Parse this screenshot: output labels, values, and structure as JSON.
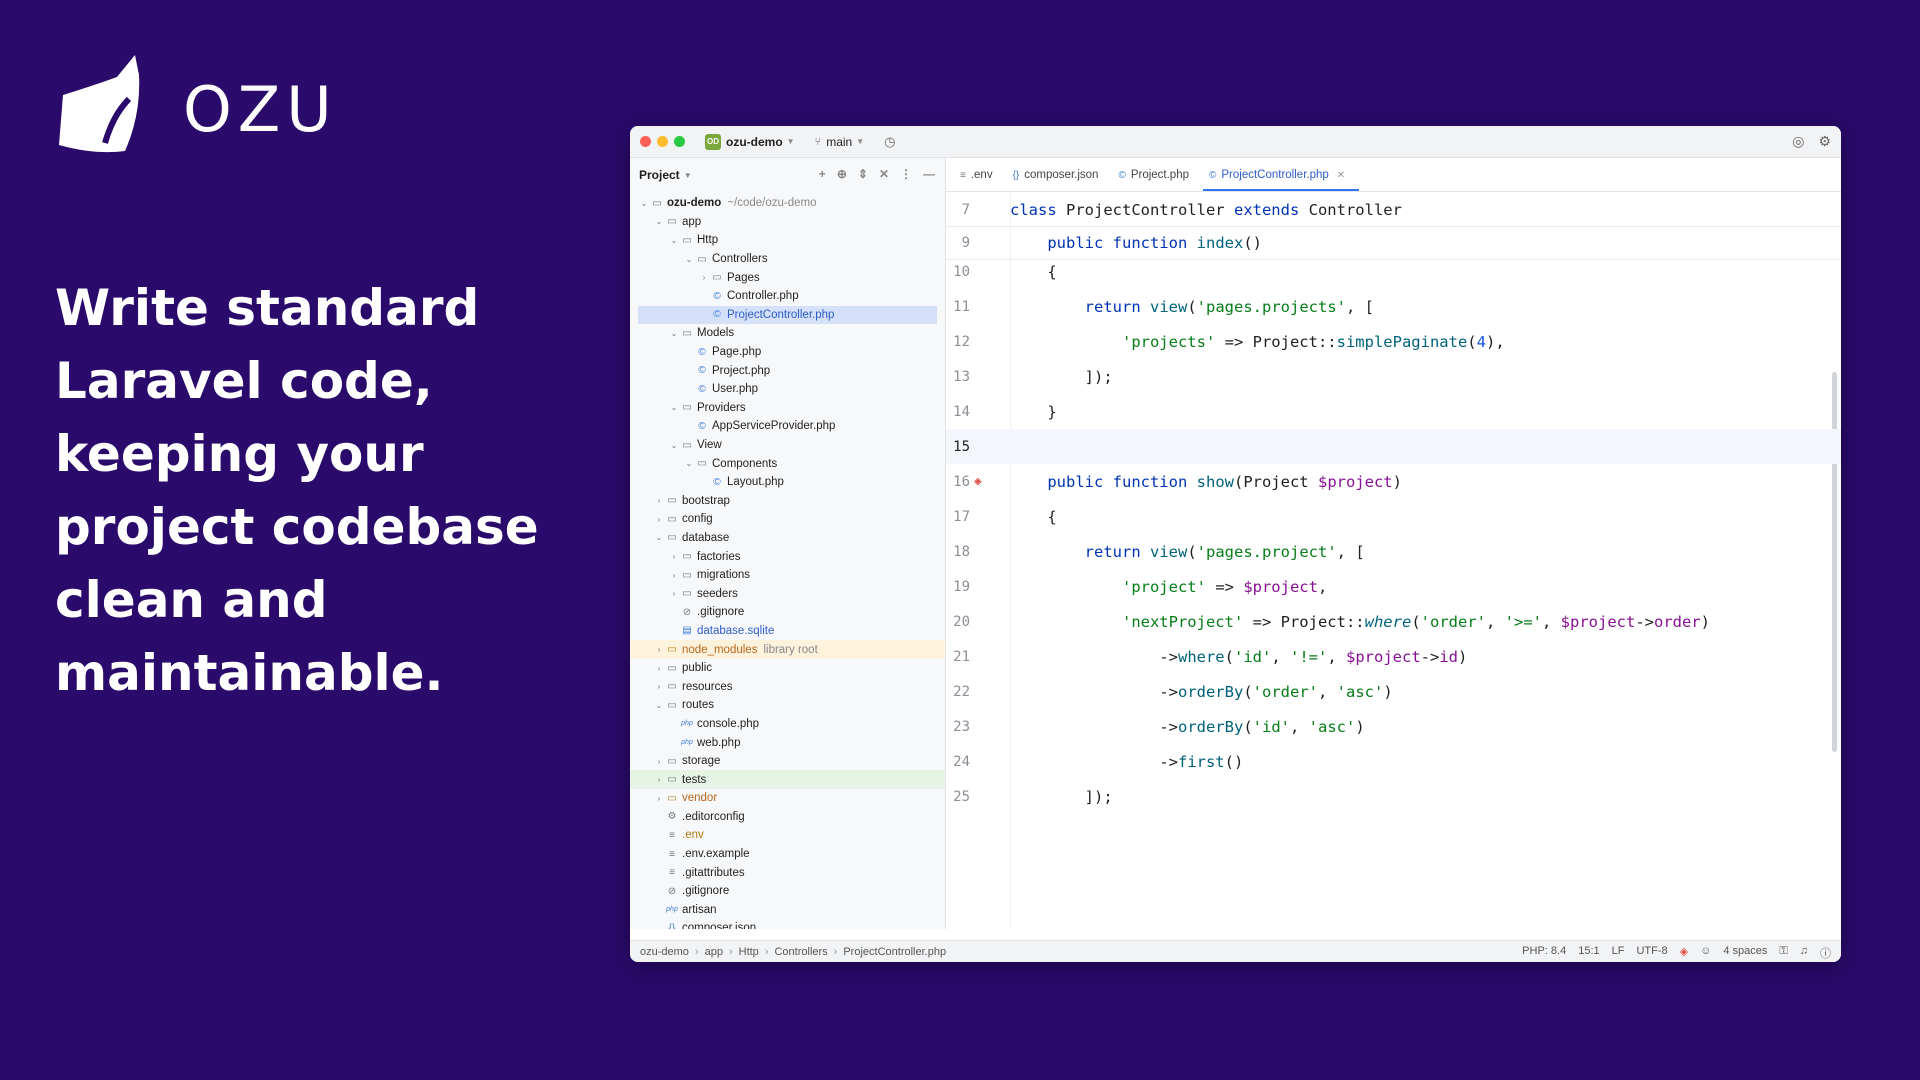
{
  "brand": {
    "name": "OZU",
    "logo_icon": "ozu-logo-icon"
  },
  "headline": "Write standard Laravel code, keeping your project codebase clean and maintainable.",
  "ide": {
    "project_name": "ozu-demo",
    "project_avatar": "OD",
    "branch": "main",
    "sidebar_title": "Project",
    "tree": [
      {
        "depth": 0,
        "arrow": "⌄",
        "icon": "folder",
        "label": "ozu-demo",
        "sub": "~/code/ozu-demo",
        "bold": true
      },
      {
        "depth": 1,
        "arrow": "⌄",
        "icon": "folder",
        "label": "app"
      },
      {
        "depth": 2,
        "arrow": "⌄",
        "icon": "folder",
        "label": "Http"
      },
      {
        "depth": 3,
        "arrow": "⌄",
        "icon": "folder",
        "label": "Controllers"
      },
      {
        "depth": 4,
        "arrow": "›",
        "icon": "folder",
        "label": "Pages"
      },
      {
        "depth": 4,
        "arrow": "",
        "icon": "php",
        "label": "Controller.php"
      },
      {
        "depth": 4,
        "arrow": "",
        "icon": "php",
        "label": "ProjectController.php",
        "selected": true
      },
      {
        "depth": 2,
        "arrow": "⌄",
        "icon": "folder",
        "label": "Models"
      },
      {
        "depth": 3,
        "arrow": "",
        "icon": "php",
        "label": "Page.php"
      },
      {
        "depth": 3,
        "arrow": "",
        "icon": "php",
        "label": "Project.php"
      },
      {
        "depth": 3,
        "arrow": "",
        "icon": "php",
        "label": "User.php"
      },
      {
        "depth": 2,
        "arrow": "⌄",
        "icon": "folder",
        "label": "Providers"
      },
      {
        "depth": 3,
        "arrow": "",
        "icon": "php",
        "label": "AppServiceProvider.php"
      },
      {
        "depth": 2,
        "arrow": "⌄",
        "icon": "folder",
        "label": "View"
      },
      {
        "depth": 3,
        "arrow": "⌄",
        "icon": "folder",
        "label": "Components"
      },
      {
        "depth": 4,
        "arrow": "",
        "icon": "php",
        "label": "Layout.php"
      },
      {
        "depth": 1,
        "arrow": "›",
        "icon": "folder",
        "label": "bootstrap"
      },
      {
        "depth": 1,
        "arrow": "›",
        "icon": "folder",
        "label": "config"
      },
      {
        "depth": 1,
        "arrow": "⌄",
        "icon": "folder",
        "label": "database"
      },
      {
        "depth": 2,
        "arrow": "›",
        "icon": "folder",
        "label": "factories"
      },
      {
        "depth": 2,
        "arrow": "›",
        "icon": "folder",
        "label": "migrations"
      },
      {
        "depth": 2,
        "arrow": "›",
        "icon": "folder",
        "label": "seeders"
      },
      {
        "depth": 2,
        "arrow": "",
        "icon": "ignore",
        "label": ".gitignore"
      },
      {
        "depth": 2,
        "arrow": "",
        "icon": "db",
        "label": "database.sqlite",
        "color": "blue"
      },
      {
        "depth": 1,
        "arrow": "›",
        "icon": "folder-yel",
        "label": "node_modules",
        "sub": "library root",
        "color": "orange",
        "lib": true
      },
      {
        "depth": 1,
        "arrow": "›",
        "icon": "folder",
        "label": "public"
      },
      {
        "depth": 1,
        "arrow": "›",
        "icon": "folder",
        "label": "resources"
      },
      {
        "depth": 1,
        "arrow": "⌄",
        "icon": "folder",
        "label": "routes"
      },
      {
        "depth": 2,
        "arrow": "",
        "icon": "phpfile",
        "label": "console.php"
      },
      {
        "depth": 2,
        "arrow": "",
        "icon": "phpfile",
        "label": "web.php"
      },
      {
        "depth": 1,
        "arrow": "›",
        "icon": "folder",
        "label": "storage"
      },
      {
        "depth": 1,
        "arrow": "›",
        "icon": "folder",
        "label": "tests",
        "tests": true
      },
      {
        "depth": 1,
        "arrow": "›",
        "icon": "folder-yel",
        "label": "vendor",
        "color": "orange"
      },
      {
        "depth": 1,
        "arrow": "",
        "icon": "gear",
        "label": ".editorconfig"
      },
      {
        "depth": 1,
        "arrow": "",
        "icon": "lines",
        "label": ".env",
        "color": "yel"
      },
      {
        "depth": 1,
        "arrow": "",
        "icon": "lines",
        "label": ".env.example"
      },
      {
        "depth": 1,
        "arrow": "",
        "icon": "lines",
        "label": ".gitattributes"
      },
      {
        "depth": 1,
        "arrow": "",
        "icon": "ignore",
        "label": ".gitignore"
      },
      {
        "depth": 1,
        "arrow": "",
        "icon": "phpfile",
        "label": "artisan"
      },
      {
        "depth": 1,
        "arrow": "",
        "icon": "json",
        "label": "composer.json"
      }
    ],
    "tabs": [
      {
        "label": ".env",
        "icon": "lines"
      },
      {
        "label": "composer.json",
        "icon": "json"
      },
      {
        "label": "Project.php",
        "icon": "php"
      },
      {
        "label": "ProjectController.php",
        "icon": "php",
        "active": true
      }
    ],
    "code": [
      {
        "n": "7",
        "html": "<span class='kw'>class</span> ProjectController <span class='kw'>extends</span> Controller",
        "sticky": true
      },
      {
        "n": "9",
        "html": "    <span class='kw'>public function</span> <span class='fn'>index</span>()",
        "sticky": true
      },
      {
        "n": "10",
        "html": "    {"
      },
      {
        "n": "11",
        "html": "        <span class='kw'>return</span> <span class='fn'>view</span>(<span class='str'>'pages.projects'</span>, ["
      },
      {
        "n": "12",
        "html": "            <span class='str'>'projects'</span> => Project::<span class='fn'>simplePaginate</span>(<span class='num'>4</span>),"
      },
      {
        "n": "13",
        "html": "        ]);"
      },
      {
        "n": "14",
        "html": "    }"
      },
      {
        "n": "15",
        "html": "",
        "current": true
      },
      {
        "n": "16",
        "html": "    <span class='kw'>public function</span> <span class='fn'>show</span>(Project <span class='var'>$project</span>)",
        "laravel": true
      },
      {
        "n": "17",
        "html": "    {"
      },
      {
        "n": "18",
        "html": "        <span class='kw'>return</span> <span class='fn'>view</span>(<span class='str'>'pages.project'</span>, ["
      },
      {
        "n": "19",
        "html": "            <span class='str'>'project'</span> => <span class='var'>$project</span>,"
      },
      {
        "n": "20",
        "html": "            <span class='str'>'nextProject'</span> => Project::<span class='it'>where</span>(<span class='str'>'order'</span>, <span class='str'>'>='</span>, <span class='var'>$project</span>-><span class='prop'>order</span>)"
      },
      {
        "n": "21",
        "html": "                -><span class='fn'>where</span>(<span class='str'>'id'</span>, <span class='str'>'!='</span>, <span class='var'>$project</span>-><span class='prop'>id</span>)"
      },
      {
        "n": "22",
        "html": "                -><span class='fn'>orderBy</span>(<span class='str'>'order'</span>, <span class='str'>'asc'</span>)"
      },
      {
        "n": "23",
        "html": "                -><span class='fn'>orderBy</span>(<span class='str'>'id'</span>, <span class='str'>'asc'</span>)"
      },
      {
        "n": "24",
        "html": "                -><span class='fn'>first</span>()"
      },
      {
        "n": "25",
        "html": "        ]);"
      }
    ],
    "breadcrumbs": [
      "ozu-demo",
      "app",
      "Http",
      "Controllers",
      "ProjectController.php"
    ],
    "status": {
      "php": "PHP: 8.4",
      "pos": "15:1",
      "eol": "LF",
      "encoding": "UTF-8",
      "indent": "4 spaces"
    }
  }
}
